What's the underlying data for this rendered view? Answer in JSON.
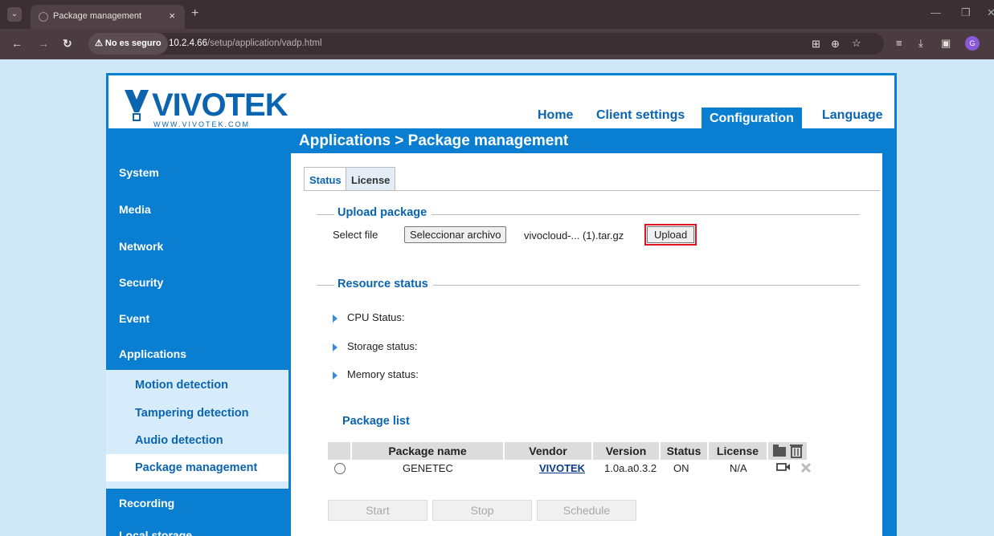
{
  "browser": {
    "tab_title": "Package management",
    "tab_close": "×",
    "new_tab": "+",
    "security_label": "⚠ No es seguro",
    "url_host": "10.2.4.66",
    "url_path": "/setup/application/vadp.html",
    "profile_initial": "G"
  },
  "logo": {
    "name": "VIVOTEK",
    "site": "WWW.VIVOTEK.COM"
  },
  "topnav": {
    "home": "Home",
    "client_settings": "Client settings",
    "configuration": "Configuration",
    "language": "Language"
  },
  "breadcrumb": "Applications > Package management",
  "sidebar": {
    "items": [
      "System",
      "Media",
      "Network",
      "Security",
      "Event",
      "Applications",
      "Recording",
      "Local storage"
    ],
    "sub_items": [
      "Motion detection",
      "Tampering detection",
      "Audio detection",
      "Package management"
    ]
  },
  "tabs": {
    "status": "Status",
    "license": "License"
  },
  "upload": {
    "section_title": "Upload package",
    "select_label": "Select file",
    "choose_button": "Seleccionar archivo",
    "file_name": "vivocloud-... (1).tar.gz",
    "upload_button": "Upload"
  },
  "resource": {
    "section_title": "Resource status",
    "cpu": "CPU Status:",
    "storage": "Storage status:",
    "memory": "Memory status:"
  },
  "package_list": {
    "title": "Package list",
    "columns": [
      "Package name",
      "Vendor",
      "Version",
      "Status",
      "License"
    ],
    "rows": [
      {
        "name": "GENETEC",
        "vendor": "VIVOTEK",
        "version": "1.0a.a0.3.2",
        "status": "ON",
        "license": "N/A"
      }
    ]
  },
  "actions": {
    "start": "Start",
    "stop": "Stop",
    "schedule": "Schedule"
  },
  "colors": {
    "brand_blue": "#0a7fd1",
    "highlight_red": "#e0141e"
  }
}
